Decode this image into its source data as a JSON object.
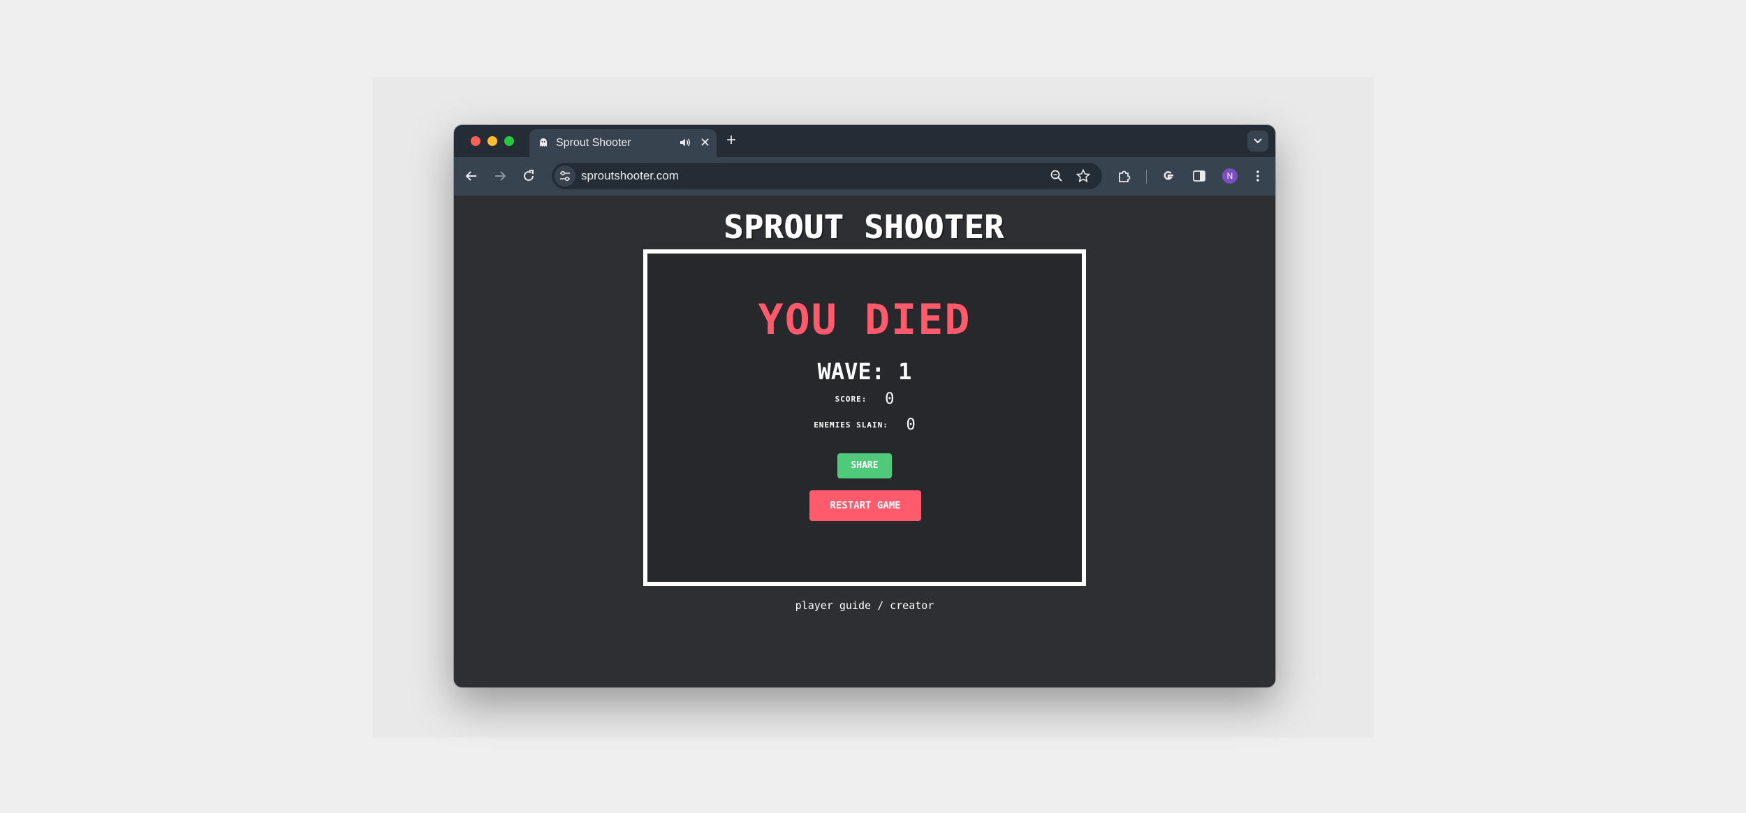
{
  "browser": {
    "tab": {
      "title": "Sprout Shooter",
      "favicon": "ghost-icon",
      "audio_icon": "speaker-icon",
      "close_glyph": "✕"
    },
    "new_tab_glyph": "+",
    "url": "sproutshooter.com",
    "profile_initial": "N",
    "colors": {
      "tabstrip": "#242d35",
      "toolbar": "#37444f",
      "avatar": "#7b4fbf"
    }
  },
  "game": {
    "title": "SPROUT SHOOTER",
    "status": "YOU DIED",
    "wave_label": "WAVE:",
    "wave_value": "1",
    "stats": [
      {
        "label": "SCORE:",
        "value": "0"
      },
      {
        "label": "ENEMIES SLAIN:",
        "value": "0"
      }
    ],
    "share_label": "SHARE",
    "restart_label": "RESTART GAME",
    "footer": {
      "guide": "player guide",
      "separator": "/",
      "creator": "creator"
    },
    "colors": {
      "accent_red": "#ff5b6c",
      "share_green": "#4fc97a",
      "frame": "#ffffff",
      "background": "#2e2f33"
    }
  }
}
